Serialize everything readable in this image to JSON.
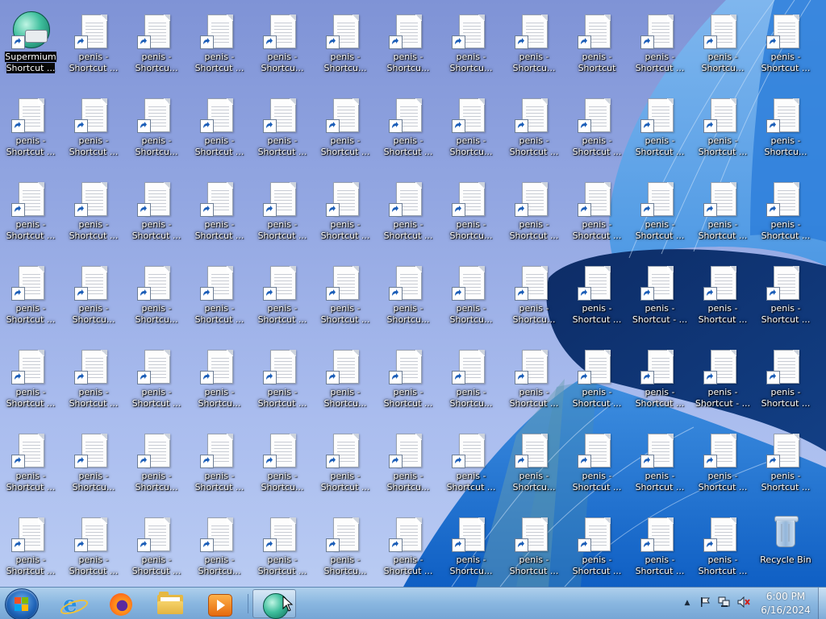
{
  "desktop": {
    "special_icons": {
      "supermium": {
        "label_line1": "Supermium",
        "label_line2": "Shortcut ...",
        "icon": "supermium-icon",
        "selected": true
      },
      "recycle_bin": {
        "label": "Recycle Bin",
        "icon": "recycle-bin-icon"
      }
    },
    "shortcut_line1": "penis -",
    "rows": [
      [
        "",
        "Shortcut ...",
        "Shortcu...",
        "Shortcut ...",
        "Shortcu...",
        "Shortcu...",
        "Shortcu...",
        "Shortcu...",
        "Shortcu...",
        "Shortcut",
        "Shortcut ...",
        "Shortcu...",
        "Shortcut ..."
      ],
      [
        "Shortcut ...",
        "Shortcut ...",
        "Shortcu...",
        "Shortcut ...",
        "Shortcut ...",
        "Shortcut ...",
        "Shortcut ...",
        "Shortcu...",
        "Shortcut ...",
        "Shortcut ...",
        "Shortcut ...",
        "Shortcut ...",
        "Shortcu..."
      ],
      [
        "Shortcut ...",
        "Shortcut ...",
        "Shortcut ...",
        "Shortcut ...",
        "Shortcut ...",
        "Shortcut ...",
        "Shortcut ...",
        "Shortcu...",
        "Shortcut ...",
        "Shortcut ...",
        "Shortcut ...",
        "Shortcut ...",
        "Shortcut ..."
      ],
      [
        "Shortcut ...",
        "Shortcu...",
        "Shortcu...",
        "Shortcut ...",
        "Shortcut ...",
        "Shortcut ...",
        "Shortcu...",
        "Shortcu...",
        "Shortcu...",
        "Shortcut ...",
        "Shortcut - ...",
        "Shortcut ...",
        "Shortcut ..."
      ],
      [
        "Shortcut ...",
        "Shortcut ...",
        "Shortcut ...",
        "Shortcu...",
        "Shortcut ...",
        "Shortcu...",
        "Shortcut ...",
        "Shortcu...",
        "Shortcut ...",
        "Shortcut ...",
        "Shortcut ...",
        "Shortcut - ...",
        "Shortcut ..."
      ],
      [
        "Shortcut ...",
        "Shortcu...",
        "Shortcu...",
        "Shortcut ...",
        "Shortcu...",
        "Shortcut ...",
        "Shortcu...",
        "Shortcut ...",
        "Shortcu...",
        "Shortcut ...",
        "Shortcut ...",
        "Shortcut ...",
        "Shortcut ..."
      ],
      [
        "Shortcut ...",
        "Shortcut ...",
        "Shortcut ...",
        "Shortcu...",
        "Shortcut ...",
        "Shortcu...",
        "Shortcut ...",
        "Shortcu...",
        "Shortcut ...",
        "Shortcut ...",
        "Shortcut ...",
        "Shortcut ...",
        ""
      ]
    ]
  },
  "taskbar": {
    "start_button": {
      "icon": "windows-logo-icon"
    },
    "pinned": [
      {
        "name": "internet-explorer",
        "icon": "internet-explorer-icon"
      },
      {
        "name": "firefox",
        "icon": "firefox-icon"
      },
      {
        "name": "file-explorer",
        "icon": "folder-icon"
      },
      {
        "name": "media-player",
        "icon": "media-player-icon"
      },
      {
        "name": "supermium",
        "icon": "supermium-icon",
        "active": true
      }
    ],
    "tray": {
      "show_hidden": "▲",
      "icons": [
        "action-center-flag-icon",
        "network-icon",
        "volume-muted-icon"
      ]
    },
    "clock": {
      "time": "6:00 PM",
      "date": "6/16/2024"
    }
  },
  "colors": {
    "wallpaper_sky": "#93a7e2",
    "wallpaper_blue": "#1d6fd0",
    "wallpaper_dark": "#0b2f6a",
    "label_text": "#ffffff",
    "taskbar": "#82b2de"
  }
}
